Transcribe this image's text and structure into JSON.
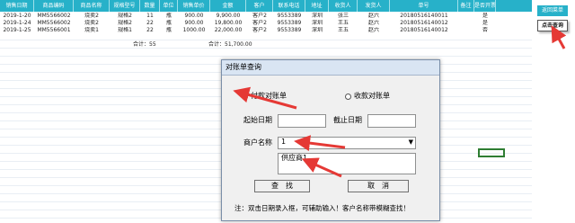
{
  "sheet": {
    "headers": [
      "销售日期",
      "商品编码",
      "商品名称",
      "规格型号",
      "数量",
      "单位",
      "销售单价",
      "金额",
      "客户",
      "联系电话",
      "地址",
      "收货人",
      "发货人",
      "单号",
      "备注",
      "是否开票"
    ],
    "rows": [
      [
        "2019-1-20",
        "MM5566002",
        "烧卖2",
        "规格2",
        "11",
        "瓶",
        "900.00",
        "9,900.00",
        "客户2",
        "9553389",
        "深圳",
        "张三",
        "赵六",
        "20180516140011",
        "",
        "是"
      ],
      [
        "2019-1-24",
        "MM5566002",
        "烧卖2",
        "规格2",
        "22",
        "瓶",
        "900.00",
        "19,800.00",
        "客户2",
        "9553389",
        "深圳",
        "王五",
        "赵六",
        "20180516140012",
        "",
        "是"
      ],
      [
        "2019-1-25",
        "MM5566001",
        "烧卖1",
        "规格1",
        "22",
        "瓶",
        "1000.00",
        "22,000.00",
        "客户2",
        "9553389",
        "深圳",
        "王五",
        "赵六",
        "20180516140012",
        "",
        "否"
      ]
    ],
    "totals": {
      "qty": "合计：55",
      "amount": "合计：51,700.00"
    }
  },
  "side": {
    "return_label": "返回菜单",
    "query_label": "点击查询"
  },
  "dialog": {
    "title": "对账单查询",
    "radio_payment": "付款对账单",
    "radio_receipt": "收款对账单",
    "start_label": "起始日期",
    "end_label": "截止日期",
    "merchant_label": "商户名称",
    "merchant_value": "1",
    "suggestion": "供应商1",
    "search_button": "查　找",
    "cancel_button": "取　消",
    "note": "注：双击日期录入框，可辅助输入！客户名称带模糊查找！"
  },
  "colors": {
    "header_bg": "#27b1c9",
    "arrow": "#e53935",
    "selection": "#2e7d32"
  }
}
